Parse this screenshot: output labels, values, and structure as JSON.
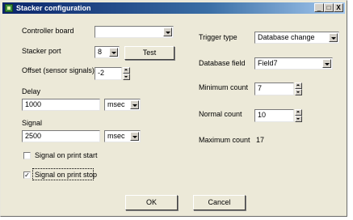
{
  "window": {
    "title": "Stacker configuration",
    "controls": {
      "minimize": "_",
      "maximize": "□",
      "close": "X"
    }
  },
  "left": {
    "controller_board": {
      "label": "Controller board",
      "value": ""
    },
    "stacker_port": {
      "label": "Stacker port",
      "value": "8",
      "test_button": "Test"
    },
    "offset": {
      "label": "Offset (sensor signals)",
      "value": "-2"
    },
    "delay": {
      "label": "Delay",
      "value": "1000",
      "unit": "msec"
    },
    "signal": {
      "label": "Signal",
      "value": "2500",
      "unit": "msec"
    },
    "signal_on_print_start": {
      "label": "Signal on print start",
      "checked": false
    },
    "signal_on_print_stop": {
      "label": "Signal on print stop",
      "checked": true
    }
  },
  "right": {
    "trigger_type": {
      "label": "Trigger type",
      "value": "Database change"
    },
    "database_field": {
      "label": "Database field",
      "value": "Field7"
    },
    "minimum_count": {
      "label": "Minimum count",
      "value": "7"
    },
    "normal_count": {
      "label": "Normal count",
      "value": "10"
    },
    "maximum_count": {
      "label": "Maximum count",
      "value": "17"
    }
  },
  "footer": {
    "ok": "OK",
    "cancel": "Cancel"
  },
  "check_glyph": "✓"
}
